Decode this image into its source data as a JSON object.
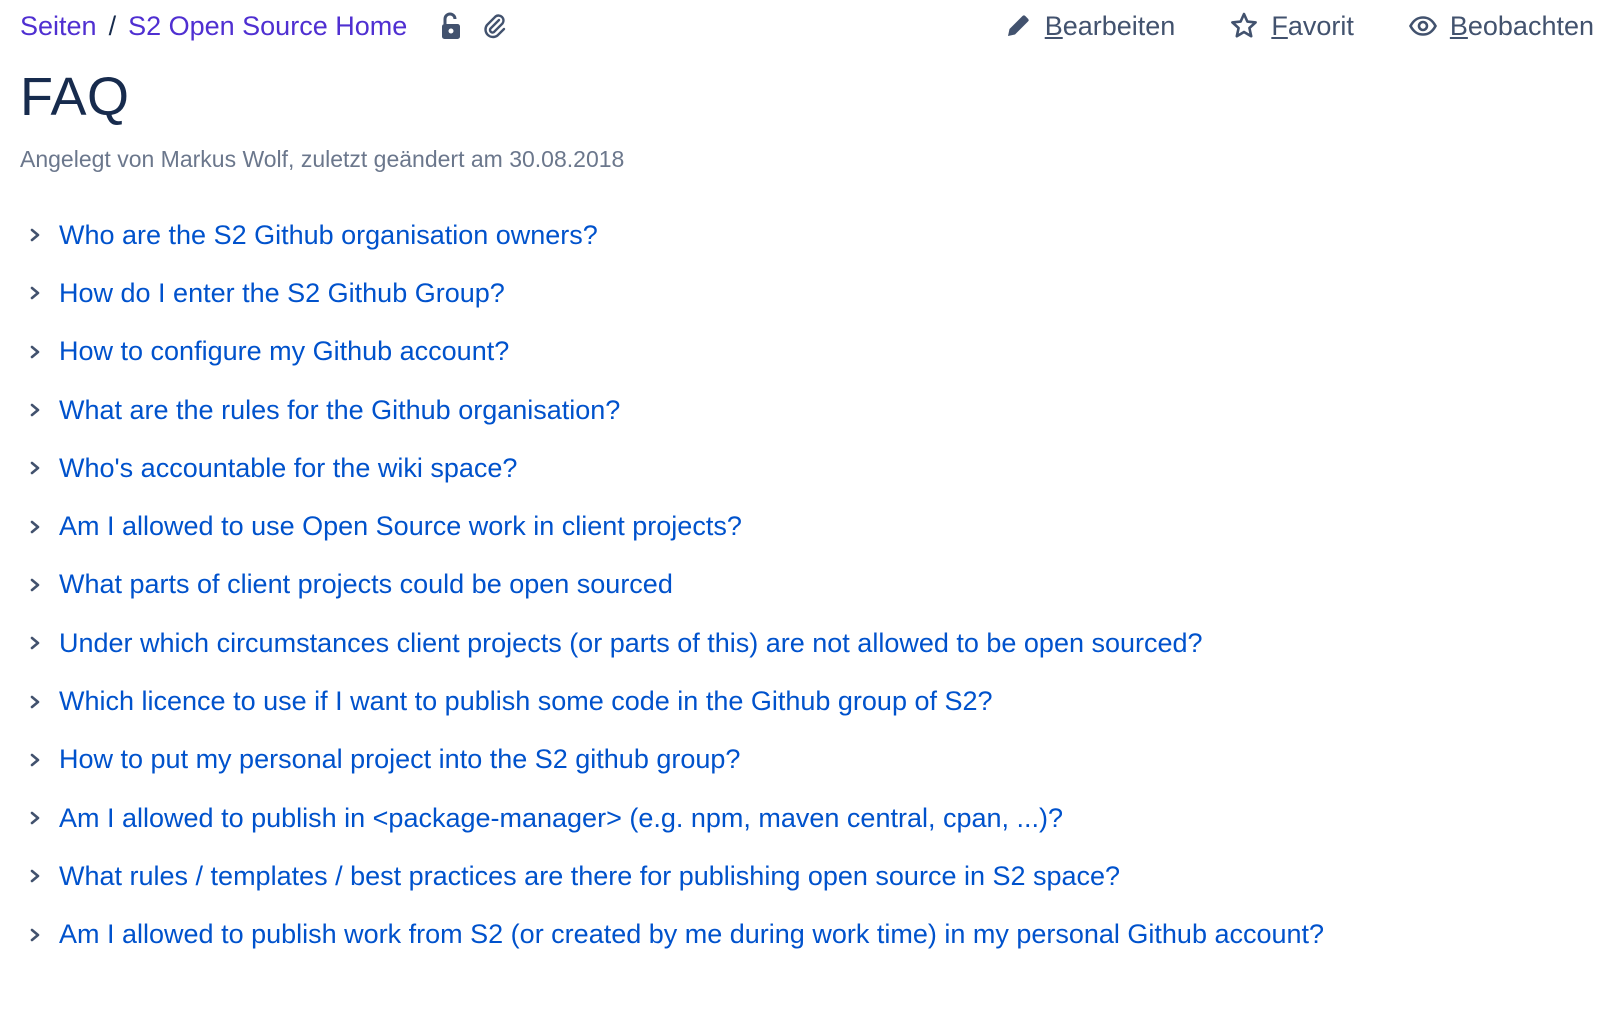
{
  "breadcrumb": {
    "root": "Seiten",
    "separator": "/",
    "parent": "S2 Open Source Home",
    "icons": [
      "unlock-icon",
      "attachment-icon"
    ]
  },
  "actions": {
    "edit": {
      "accel": "B",
      "rest": "earbeiten",
      "icon": "pencil-icon"
    },
    "favorite": {
      "accel": "F",
      "rest": "avorit",
      "icon": "star-icon"
    },
    "watch": {
      "accel": "B",
      "rest": "eobachten",
      "icon": "eye-icon"
    }
  },
  "page": {
    "title": "FAQ",
    "meta": "Angelegt von Markus Wolf, zuletzt geändert am 30.08.2018"
  },
  "faq": [
    "Who are the S2 Github organisation owners?",
    "How do I enter the S2 Github Group?",
    "How to configure my Github account?",
    "What are the rules for the Github organisation?",
    "Who's accountable for the wiki space?",
    "Am I allowed to use Open Source work in client projects?",
    "What parts of client projects could be open sourced",
    "Under which circumstances client projects (or parts of this) are not allowed to be open sourced?",
    "Which licence to use if I want to publish some code in the Github group of S2?",
    "How to put my personal project into the S2 github group?",
    "Am I allowed to publish in <package-manager> (e.g. npm, maven central, cpan, ...)?",
    "What rules / templates / best practices are there for publishing open source in S2 space?",
    "Am I allowed to publish work from S2 (or created by me during work time) in my personal Github account?"
  ],
  "colors": {
    "link": "#0052cc",
    "breadcrumb_link": "#4f2fd1",
    "heading": "#172b4d",
    "meta": "#6b778c",
    "action": "#42526e"
  }
}
